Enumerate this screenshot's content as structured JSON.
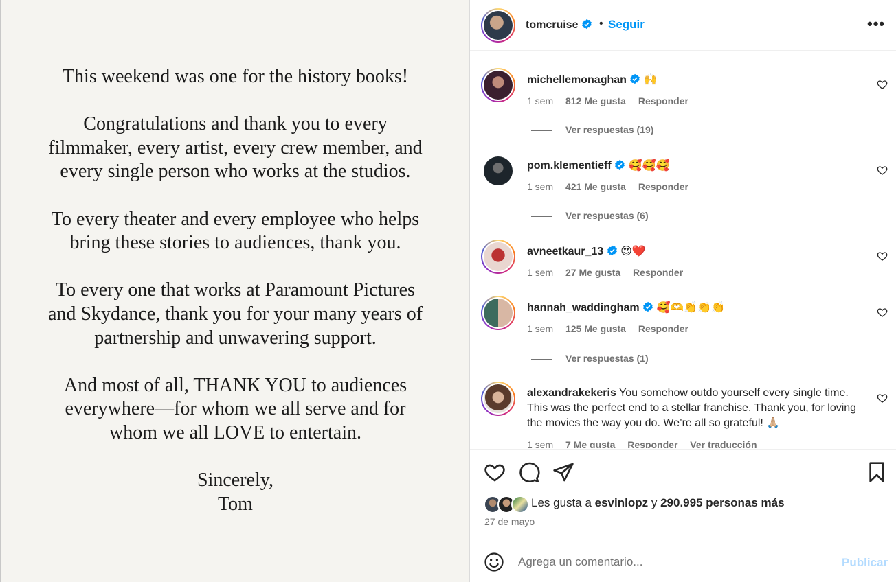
{
  "post": {
    "letter": [
      "This weekend was one for the history books!",
      "Congratulations and thank you to every filmmaker, every artist, every crew member, and every single person who works at the studios.",
      "To every theater and every employee who helps bring these stories to audiences, thank you.",
      "To every one that works at Paramount Pictures and Skydance, thank you for your many years of partnership and unwavering support.",
      "And most of all, THANK YOU to audiences everywhere—for whom we all serve and for whom we all LOVE to entertain.",
      "Sincerely, Tom"
    ],
    "letter_lines": [
      [
        "This weekend was one for the history books!"
      ],
      [
        "Congratulations and thank you to every",
        "filmmaker, every artist, every crew member, and",
        "every single person who works at the studios."
      ],
      [
        "To every theater and every employee who helps",
        "bring these stories to audiences, thank you."
      ],
      [
        "To every one that works at Paramount Pictures",
        "and Skydance, thank you for your many years of",
        "partnership and unwavering support."
      ],
      [
        "And most of all, THANK YOU to audiences",
        "everywhere—for whom we all serve and for",
        "whom we all LOVE to entertain."
      ],
      [
        "Sincerely,",
        "Tom"
      ]
    ]
  },
  "header": {
    "username": "tomcruise",
    "separator": "•",
    "follow_label": "Seguir",
    "more_label": "•••"
  },
  "comments": [
    {
      "username": "michellemonaghan",
      "text": "🙌",
      "time": "1 sem",
      "likes": "812 Me gusta",
      "reply": "Responder",
      "replies_label": "Ver respuestas (19)"
    },
    {
      "username": "pom.klementieff",
      "text": "🥰🥰🥰",
      "time": "1 sem",
      "likes": "421 Me gusta",
      "reply": "Responder",
      "replies_label": "Ver respuestas (6)"
    },
    {
      "username": "avneetkaur_13",
      "text": "😍❤️",
      "time": "1 sem",
      "likes": "27 Me gusta",
      "reply": "Responder"
    },
    {
      "username": "hannah_waddingham",
      "text": "🥰🫶👏👏👏",
      "time": "1 sem",
      "likes": "125 Me gusta",
      "reply": "Responder",
      "replies_label": "Ver respuestas (1)"
    },
    {
      "username": "alexandrakekeris",
      "text": "You somehow outdo yourself every single time. This was the perfect end to a stellar franchise. Thank you, for loving the movies the way you do. We’re all so grateful! 🙏🏼",
      "time": "1 sem",
      "likes": "7 Me gusta",
      "reply": "Responder",
      "translate": "Ver traducción"
    }
  ],
  "actions": {
    "liked_prefix": "Les gusta a",
    "liked_user": "esvinlopz",
    "liked_and": "y",
    "liked_others": "290.995 personas más",
    "date": "27 de mayo"
  },
  "add_comment": {
    "placeholder": "Agrega un comentario...",
    "publish_label": "Publicar"
  },
  "colors": {
    "accent": "#0095f6",
    "verified": "#0095f6",
    "muted_text": "#737373",
    "publish_disabled": "#b3dbff",
    "image_background": "#f5f4f0"
  },
  "icons": [
    "verified-badge-icon",
    "more-options-icon",
    "heart-icon",
    "comment-icon",
    "share-icon",
    "bookmark-icon",
    "emoji-icon"
  ]
}
